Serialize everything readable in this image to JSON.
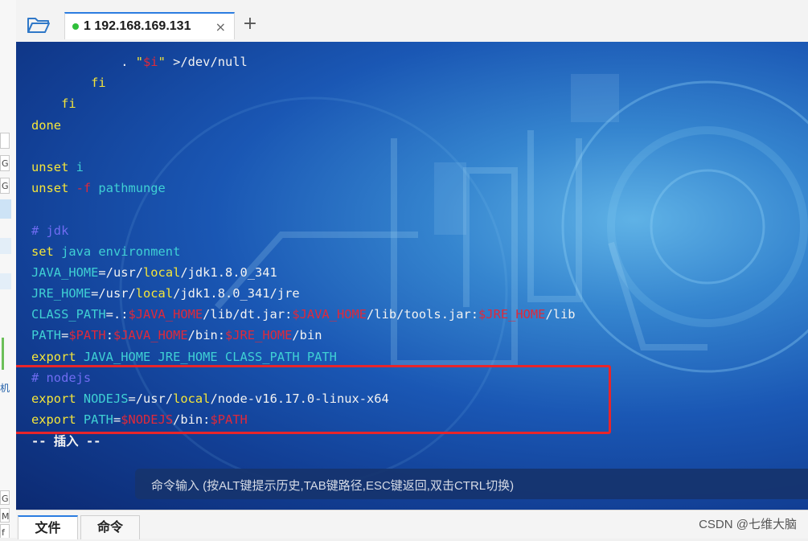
{
  "window": {
    "tab_label": "1 192.168.169.131",
    "tab_close": "×",
    "new_tab": "+"
  },
  "left_strip": {
    "items": [
      "G",
      "G",
      "机",
      "G",
      "M",
      "f"
    ]
  },
  "terminal": {
    "lines": [
      [
        {
          "t": "            . ",
          "c": "w"
        },
        {
          "t": "\"",
          "c": "y"
        },
        {
          "t": "$i",
          "c": "r"
        },
        {
          "t": "\"",
          "c": "y"
        },
        {
          "t": " >/dev/null",
          "c": "w"
        }
      ],
      [
        {
          "t": "        fi",
          "c": "y"
        }
      ],
      [
        {
          "t": "    fi",
          "c": "y"
        }
      ],
      [
        {
          "t": "done",
          "c": "y"
        }
      ],
      [
        {
          "t": "",
          "c": "w"
        }
      ],
      [
        {
          "t": "unset ",
          "c": "y"
        },
        {
          "t": "i",
          "c": "c"
        }
      ],
      [
        {
          "t": "unset ",
          "c": "y"
        },
        {
          "t": "-f",
          "c": "r"
        },
        {
          "t": " pathmunge",
          "c": "c"
        }
      ],
      [
        {
          "t": "",
          "c": "w"
        }
      ],
      [
        {
          "t": "# jdk",
          "c": "b"
        }
      ],
      [
        {
          "t": "set ",
          "c": "y"
        },
        {
          "t": "java environment",
          "c": "c"
        }
      ],
      [
        {
          "t": "JAVA_HOME",
          "c": "c"
        },
        {
          "t": "=/usr/",
          "c": "w"
        },
        {
          "t": "local",
          "c": "y"
        },
        {
          "t": "/jdk1.8.0_341",
          "c": "w"
        }
      ],
      [
        {
          "t": "JRE_HOME",
          "c": "c"
        },
        {
          "t": "=/usr/",
          "c": "w"
        },
        {
          "t": "local",
          "c": "y"
        },
        {
          "t": "/jdk1.8.0_341/jre",
          "c": "w"
        }
      ],
      [
        {
          "t": "CLASS_PATH",
          "c": "c"
        },
        {
          "t": "=.:",
          "c": "w"
        },
        {
          "t": "$JAVA_HOME",
          "c": "r"
        },
        {
          "t": "/lib/dt.jar:",
          "c": "w"
        },
        {
          "t": "$JAVA_HOME",
          "c": "r"
        },
        {
          "t": "/lib/tools.jar:",
          "c": "w"
        },
        {
          "t": "$JRE_HOME",
          "c": "r"
        },
        {
          "t": "/lib",
          "c": "w"
        }
      ],
      [
        {
          "t": "PATH",
          "c": "c"
        },
        {
          "t": "=",
          "c": "w"
        },
        {
          "t": "$PATH",
          "c": "r"
        },
        {
          "t": ":",
          "c": "w"
        },
        {
          "t": "$JAVA_HOME",
          "c": "r"
        },
        {
          "t": "/bin:",
          "c": "w"
        },
        {
          "t": "$JRE_HOME",
          "c": "r"
        },
        {
          "t": "/bin",
          "c": "w"
        }
      ],
      [
        {
          "t": "export ",
          "c": "y"
        },
        {
          "t": "JAVA_HOME JRE_HOME CLASS_PATH PATH",
          "c": "c"
        }
      ],
      [
        {
          "t": "# nodejs",
          "c": "b"
        }
      ],
      [
        {
          "t": "export ",
          "c": "y"
        },
        {
          "t": "NODEJS",
          "c": "c"
        },
        {
          "t": "=/usr/",
          "c": "w"
        },
        {
          "t": "local",
          "c": "y"
        },
        {
          "t": "/node-v16.17.0-linux-x64",
          "c": "w"
        }
      ],
      [
        {
          "t": "export ",
          "c": "y"
        },
        {
          "t": "PATH",
          "c": "c"
        },
        {
          "t": "=",
          "c": "w"
        },
        {
          "t": "$NODEJS",
          "c": "r"
        },
        {
          "t": "/bin:",
          "c": "w"
        },
        {
          "t": "$PATH",
          "c": "r"
        }
      ]
    ],
    "mode": "-- 插入 --"
  },
  "command_bar": {
    "placeholder": "命令输入 (按ALT键提示历史,TAB键路径,ESC键返回,双击CTRL切换)"
  },
  "bottom_tabs": [
    "文件",
    "命令"
  ],
  "watermark": "CSDN @七维大脑",
  "colors": {
    "accent": "#2b7de1",
    "highlight_box": "#e8252a",
    "keyword": "#f4e53a",
    "identifier": "#3fd0d4",
    "variable": "#e0293a",
    "comment": "#6f6cf2"
  }
}
